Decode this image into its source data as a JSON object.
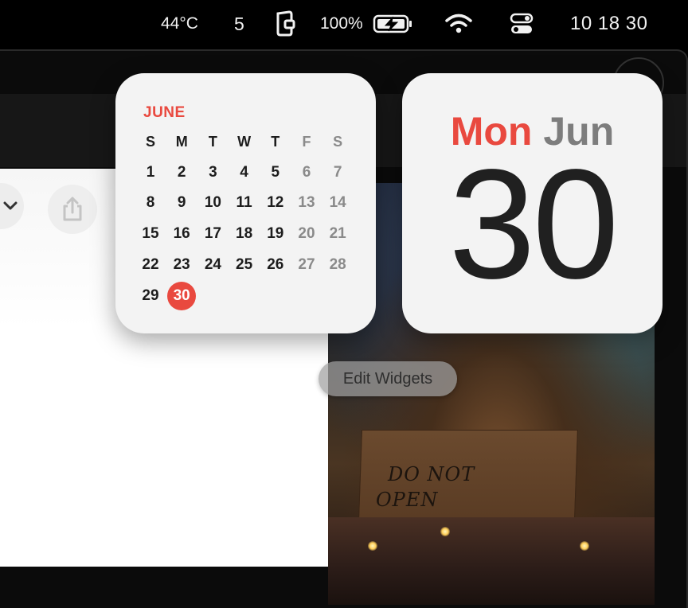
{
  "menubar": {
    "temperature": "44°C",
    "number": "5",
    "battery_percent": "100%",
    "clock": "10 18 30",
    "icons": [
      "wallet-icon",
      "battery-charging-icon",
      "wifi-icon",
      "control-center-icon"
    ]
  },
  "calendar_widget": {
    "month": "JUNE",
    "weekdays": [
      "S",
      "M",
      "T",
      "W",
      "T",
      "F",
      "S"
    ],
    "weeks": [
      [
        "1",
        "2",
        "3",
        "4",
        "5",
        "6",
        "7"
      ],
      [
        "8",
        "9",
        "10",
        "11",
        "12",
        "13",
        "14"
      ],
      [
        "15",
        "16",
        "17",
        "18",
        "19",
        "20",
        "21"
      ],
      [
        "22",
        "23",
        "24",
        "25",
        "26",
        "27",
        "28"
      ],
      [
        "29",
        "30",
        "",
        "",
        "",
        "",
        ""
      ]
    ],
    "today": "30",
    "accent_color": "#e9493f"
  },
  "date_widget": {
    "weekday": "Mon",
    "month": "Jun",
    "day": "30"
  },
  "edit_widgets_label": "Edit Widgets",
  "wallpaper": {
    "sign_line1": "DO NOT",
    "sign_line2": "OPEN"
  }
}
